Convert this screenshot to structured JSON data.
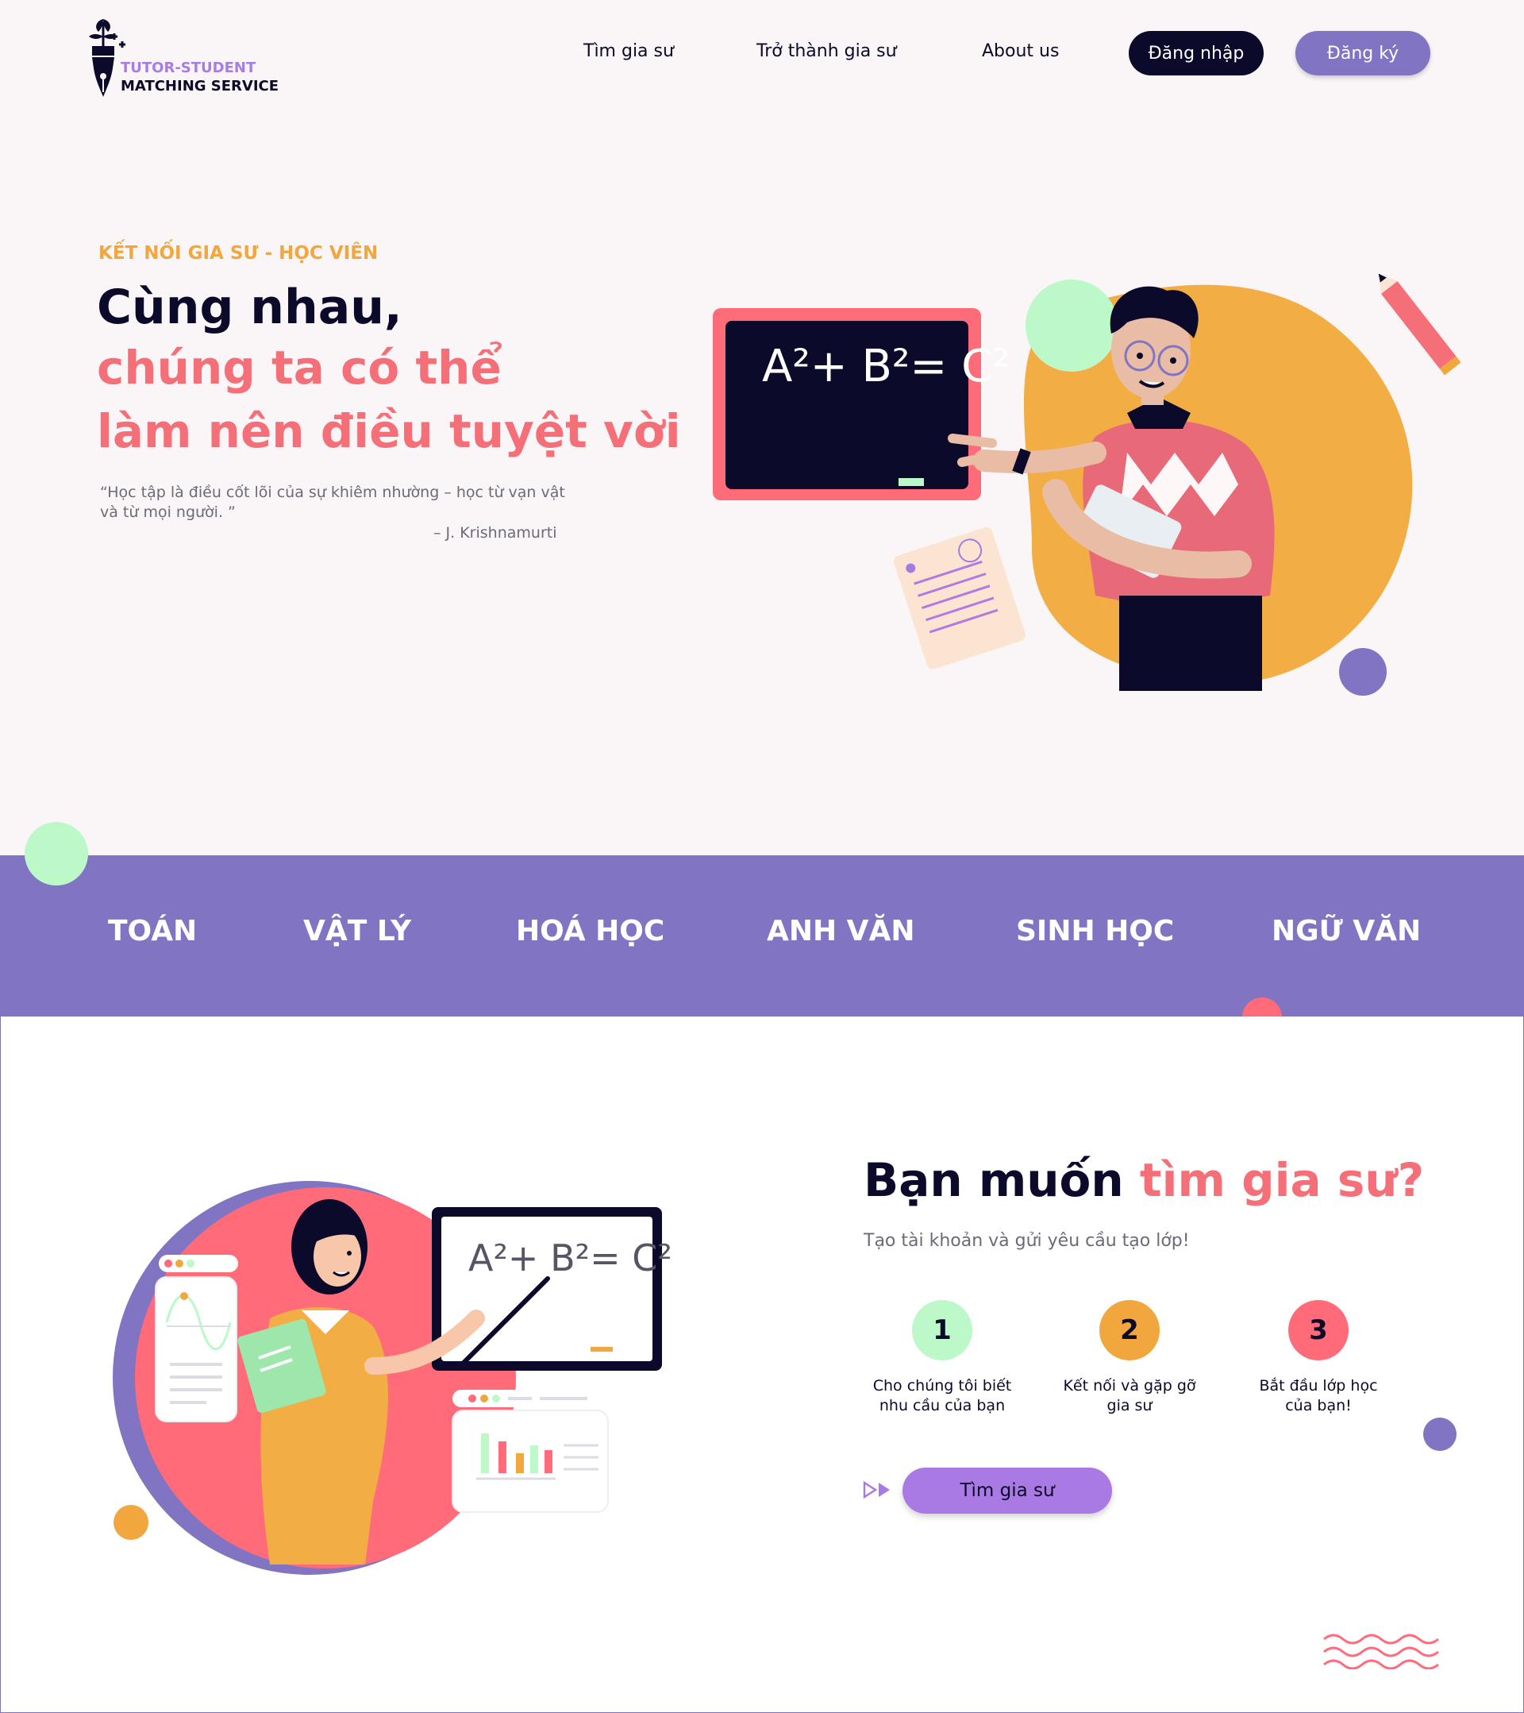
{
  "brand": {
    "line1": "TUTOR-STUDENT",
    "line2": "MATCHING SERVICE",
    "icon": "pen-plant-icon"
  },
  "nav": {
    "items": [
      "Tìm gia sư",
      "Trở thành gia sư",
      "About us"
    ],
    "login": "Đăng nhập",
    "signup": "Đăng ký"
  },
  "hero": {
    "eyebrow": "KẾT NỐI GIA SƯ - HỌC VIÊN",
    "title_line1": "Cùng nhau,",
    "title_line2": "chúng ta có thể",
    "title_line3": "làm nên điều tuyệt vời",
    "quote": "“Học tập là điều cốt lõi của sự khiêm nhường – học từ vạn vật và từ mọi người. ”",
    "quote_author": "– J. Krishnamurti",
    "board_formula": "A²+ B²= C²"
  },
  "subjects": [
    "TOÁN",
    "VẬT LÝ",
    "HOÁ HỌC",
    "ANH VĂN",
    "SINH HỌC",
    "NGỮ VĂN"
  ],
  "find": {
    "title_dark": "Bạn muốn ",
    "title_accent": "tìm gia sư?",
    "subtitle": "Tạo tài khoản và gửi yêu cầu tạo lớp!",
    "steps": [
      {
        "num": "1",
        "label_line1": "Cho chúng tôi biết",
        "label_line2": "nhu cầu của bạn",
        "color": "#bdf8c8"
      },
      {
        "num": "2",
        "label_line1": "Kết nối và gặp gỡ",
        "label_line2": "gia sư",
        "color": "#f2a63e"
      },
      {
        "num": "3",
        "label_line1": "Bắt đầu lớp học",
        "label_line2": "của bạn!",
        "color": "#ff6b78"
      }
    ],
    "cta": "Tìm gia sư",
    "board_formula": "A²+ B²= C²"
  },
  "colors": {
    "navy": "#0c0a2a",
    "purple": "#8074c3",
    "lilac": "#a97ae3",
    "pink": "#f46f78",
    "orange": "#f2a63e",
    "mint": "#bdf8c8"
  }
}
